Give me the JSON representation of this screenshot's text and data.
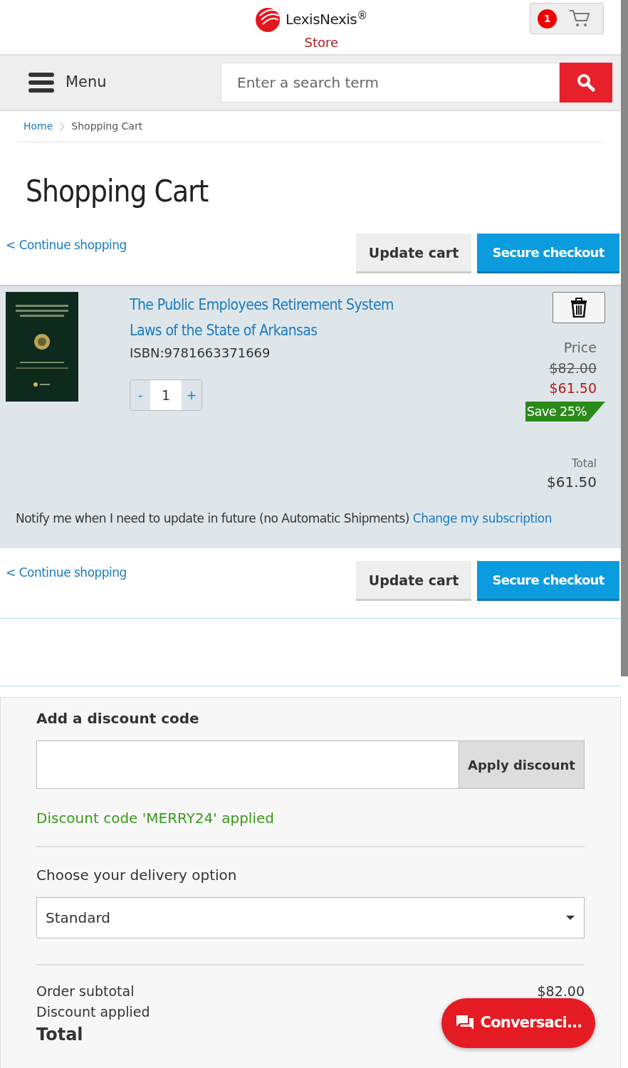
{
  "header": {
    "logo_text": "LexisNexis$^{®}$",
    "store_label": "Store",
    "cart_count": "1"
  },
  "nav": {
    "menu_label": "Menu",
    "search_placeholder": "Enter a search term"
  },
  "breadcrumb": [
    {
      "label": "Home",
      "kind": "link"
    },
    {
      "label": "Shopping Cart",
      "kind": "current"
    }
  ],
  "page_title": "Shopping Cart",
  "actions_top": {
    "continue": "< Continue shopping",
    "update": "Update cart",
    "checkout": "Secure checkout"
  },
  "item": {
    "title_lines": [
      "The Public Employees Retirement System",
      "Laws of the State of Arkansas"
    ],
    "isbn": "ISBN:9781663371669",
    "minus": "-",
    "quantity": "1",
    "plus": "+",
    "price_label": "Price",
    "old_price": "$82.00",
    "new_price": "$61.50",
    "save_badge": "Save 25%",
    "total_label": "Total",
    "total": "$61.50",
    "notify_text": "Notify me when I need to update in future (no Automatic Shipments)",
    "subscription_link": "Change my subscription"
  },
  "actions_bottom": {
    "continue": "< Continue shopping",
    "update": "Update cart",
    "checkout": "Secure checkout"
  },
  "discount": {
    "heading": "Add a discount code",
    "button": "Apply discount",
    "message": "Discount code 'MERRY24' applied"
  },
  "delivery": {
    "label": "Choose your delivery option",
    "value": "Standard"
  },
  "summary": [
    {
      "label": "Order subtotal",
      "value": "$82.00",
      "kind": "normal"
    },
    {
      "label": "Discount applied",
      "kind": "normal"
    },
    {
      "label": "Total",
      "kind": "grand"
    }
  ],
  "chat": {
    "label": "Conversaci..."
  }
}
